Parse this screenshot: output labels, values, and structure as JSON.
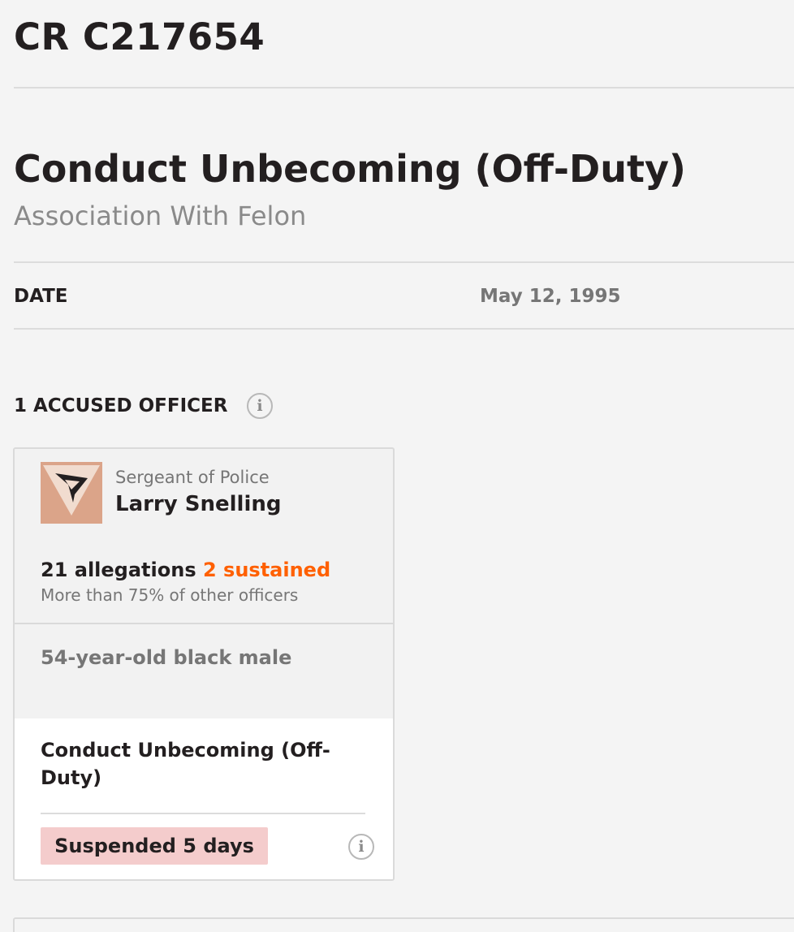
{
  "header": {
    "crid": "CR C217654"
  },
  "summary": {
    "category": "Conduct Unbecoming (Off-Duty)",
    "subcategory": "Association With Felon",
    "date_label": "DATE",
    "date_value": "May 12, 1995"
  },
  "accused": {
    "section_title": "1 ACCUSED OFFICER",
    "info_icon": "info-icon",
    "officer": {
      "rank": "Sergeant of Police",
      "name": "Larry Snelling",
      "allegations_text": "21 allegations",
      "sustained_text": "2 sustained",
      "percentile_text": "More than 75% of other officers",
      "demographic": "54-year-old black male",
      "allegation_category": "Conduct Unbecoming (Off-Duty)",
      "outcome": "Suspended 5 days",
      "avatar_color": "#dba489",
      "sustained_color": "#ff6000",
      "outcome_color": "#f4cccc"
    }
  }
}
